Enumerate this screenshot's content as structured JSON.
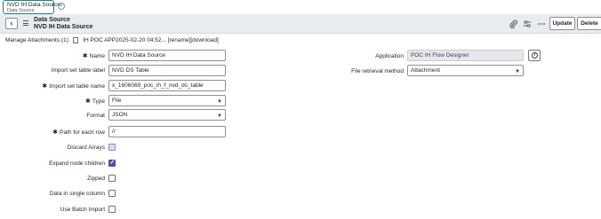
{
  "tab": {
    "title": "NVD IH Data Source",
    "subtitle": "Data Source",
    "close_icon": "close-icon"
  },
  "header": {
    "record_type": "Data Source",
    "record_name": "NVD IH Data Source",
    "update_label": "Update",
    "delete_label": "Delete",
    "icons": [
      "back-icon",
      "context-menu-icon",
      "attachment-icon",
      "settings-icon",
      "more-icon"
    ]
  },
  "attachments": {
    "label": "Manage Attachments (1):",
    "file_name": "IH POC APP2025-02-20 04:52...",
    "rename": "[rename]",
    "download": "[download]"
  },
  "form": {
    "name": {
      "label": "Name",
      "value": "NVD IH Data Source",
      "required": true
    },
    "import_set_table_label": {
      "label": "Import set table label",
      "value": "NVD DS Table"
    },
    "import_set_table_name": {
      "label": "Import set table name",
      "value": "x_1606069_poc_ih_f_nvd_ds_table",
      "required": true
    },
    "type": {
      "label": "Type",
      "value": "File",
      "required": true
    },
    "format": {
      "label": "Format",
      "value": "JSON"
    },
    "path_for_each_row": {
      "label": "Path for each row",
      "value": "//",
      "required": true
    },
    "discard_arrays": {
      "label": "Discard Arrays",
      "checked": false
    },
    "expand_node_children": {
      "label": "Expand node children",
      "checked": true
    },
    "zipped": {
      "label": "Zipped",
      "checked": false
    },
    "data_in_single_column": {
      "label": "Data in single column",
      "checked": false
    },
    "use_batch_import": {
      "label": "Use Batch Import",
      "checked": false
    },
    "application": {
      "label": "Application",
      "value": "POC IH Flow Designer"
    },
    "file_retrieval_method": {
      "label": "File retrieval method",
      "value": "Attachment"
    }
  },
  "required_marker": "✱",
  "colors": {
    "accent_teal": "#1f8476",
    "checkbox_checked": "#4a52a8",
    "header_bg": "#e9ecef"
  }
}
